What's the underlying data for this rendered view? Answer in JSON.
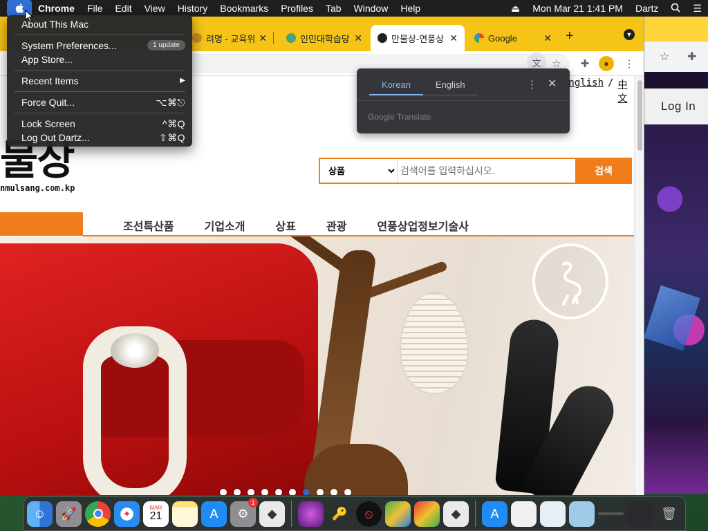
{
  "menubar": {
    "app_name": "Chrome",
    "menus": [
      "File",
      "Edit",
      "View",
      "History",
      "Bookmarks",
      "Profiles",
      "Tab",
      "Window",
      "Help"
    ],
    "datetime": "Mon Mar 21  1:41 PM",
    "user": "Dartz"
  },
  "apple_menu": {
    "about": "About This Mac",
    "system_prefs": "System Preferences...",
    "update_badge": "1 update",
    "app_store": "App Store...",
    "recent_items": "Recent Items",
    "force_quit": "Force Quit...",
    "force_quit_kbd": "⌥⌘⎋",
    "lock_screen": "Lock Screen",
    "lock_screen_kbd": "^⌘Q",
    "log_out": "Log Out Dartz...",
    "log_out_kbd": "⇧⌘Q"
  },
  "tabs": [
    {
      "title": "려명 - 교육위원",
      "active": false
    },
    {
      "title": "인민대학습당",
      "active": false
    },
    {
      "title": "만물상-연풍상",
      "active": true
    },
    {
      "title": "Google",
      "active": false
    }
  ],
  "translate_popup": {
    "lang_source": "Korean",
    "lang_target": "English",
    "footer": "Google Translate"
  },
  "page": {
    "lang_links": [
      "English",
      "中文"
    ],
    "lang_sep": "/",
    "logo_text": "물상",
    "logo_url": "nmulsang.com.kp",
    "search_category": "상품",
    "search_placeholder": "검색어를 입력하십시오.",
    "search_button": "검색",
    "nav": [
      "조선특산품",
      "기업소개",
      "상표",
      "관광",
      "연풍상업정보기술사"
    ],
    "carousel_count": 10,
    "carousel_active_index": 6
  },
  "bg_window": {
    "login_label": "Log In"
  },
  "dock": {
    "calendar_month": "MAR",
    "calendar_day": "21",
    "settings_badge": "1"
  },
  "colors": {
    "accent_orange": "#f07d1a",
    "tabstrip_yellow": "#f6c417",
    "translate_blue": "#8ab4f8"
  }
}
